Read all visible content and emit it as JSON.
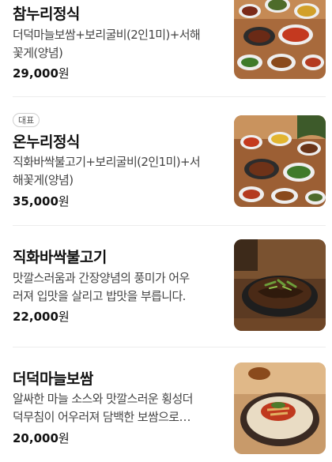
{
  "menu": {
    "items": [
      {
        "name": "참누리정식",
        "desc_lines": [
          "더덕마늘보쌈+보리굴비(2인1미)+서해",
          "꽃게(양념)"
        ],
        "price_num": "29,000",
        "price_unit": "원",
        "badge": "",
        "image_icon": "korean-set-meal-photo"
      },
      {
        "name": "온누리정식",
        "desc_lines": [
          "직화바싹불고기+보리굴비(2인1미)+서",
          "해꽃게(양념)"
        ],
        "price_num": "35,000",
        "price_unit": "원",
        "badge": "대표",
        "image_icon": "korean-set-meal-photo"
      },
      {
        "name": "직화바싹불고기",
        "desc_lines": [
          "맛깔스러움과 간장양념의 풍미가 어우",
          "러져 입맛을 살리고 밥맛을 부릅니다."
        ],
        "price_num": "22,000",
        "price_unit": "원",
        "badge": "",
        "image_icon": "bulgogi-plate-photo"
      },
      {
        "name": "더덕마늘보쌈",
        "desc_lines": [
          "알싸한 마늘 소스와 맛깔스러운 횡성더",
          "덕무침이 어우러져 담백한 보쌈으로…"
        ],
        "price_num": "20,000",
        "price_unit": "원",
        "badge": "",
        "image_icon": "bossam-bowl-photo"
      }
    ]
  },
  "colors": {
    "text_primary": "#111111",
    "text_secondary": "#444444",
    "divider": "#ececec",
    "badge_border": "#cfcfcf"
  }
}
